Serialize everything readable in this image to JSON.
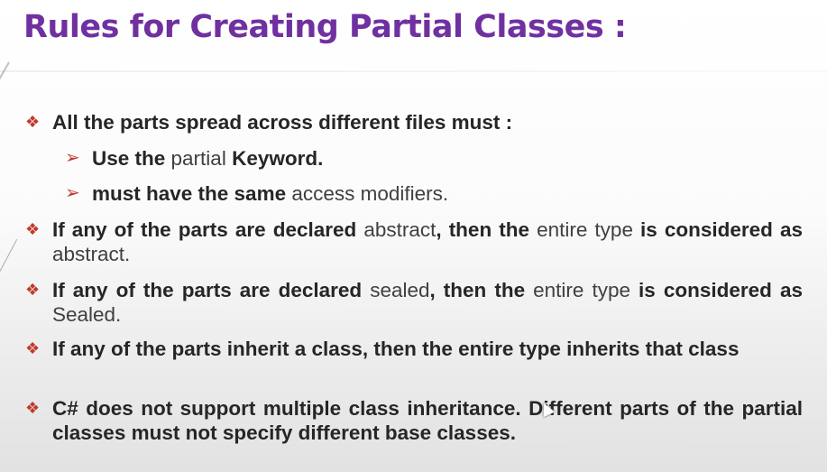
{
  "title": "Rules for Creating Partial Classes :",
  "bullets": [
    {
      "parts": [
        {
          "t": "All the parts spread across different files must :",
          "b": true
        }
      ],
      "sub": [
        {
          "parts": [
            {
              "t": "Use the ",
              "b": true
            },
            {
              "t": "partial",
              "b": false
            },
            {
              "t": " Keyword.",
              "b": true
            }
          ]
        },
        {
          "parts": [
            {
              "t": "must have the same ",
              "b": true
            },
            {
              "t": "access modifiers.",
              "b": false
            }
          ]
        }
      ]
    },
    {
      "parts": [
        {
          "t": "If any of the parts are declared ",
          "b": true
        },
        {
          "t": "abstract",
          "b": false
        },
        {
          "t": ", then the ",
          "b": true
        },
        {
          "t": "entire type ",
          "b": false
        },
        {
          "t": "is considered as ",
          "b": true
        },
        {
          "t": "abstract.",
          "b": false
        }
      ]
    },
    {
      "parts": [
        {
          "t": "If any of the parts are declared ",
          "b": true
        },
        {
          "t": "sealed",
          "b": false
        },
        {
          "t": ", then the ",
          "b": true
        },
        {
          "t": "entire type ",
          "b": false
        },
        {
          "t": "is considered as ",
          "b": true
        },
        {
          "t": "Sealed.",
          "b": false
        }
      ]
    },
    {
      "parts": [
        {
          "t": "If any of the parts inherit a class, then the entire type inherits that class",
          "b": true
        }
      ]
    },
    {
      "parts": [
        {
          "t": "C# does not support multiple class inheritance. Different parts of the partial classes must not specify different base classes.",
          "b": true
        }
      ]
    }
  ],
  "icons": {
    "diamond_bullet": "four-diamond-bullet-icon",
    "arrow_bullet": "arrowhead-bullet-icon",
    "cursor": "mouse-pointer-icon"
  },
  "colors": {
    "title": "#7030a0",
    "bullet": "#c0392b",
    "text": "#262626"
  }
}
